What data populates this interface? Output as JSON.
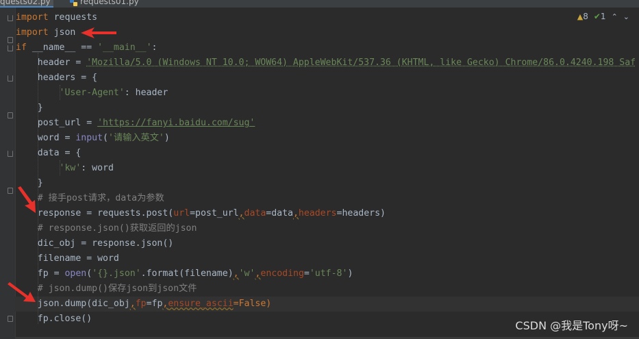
{
  "tabs": [
    {
      "label": "quests02.py",
      "active": true
    },
    {
      "label": "requests01.py",
      "active": false
    }
  ],
  "inspections": {
    "warnings": "8",
    "weak_warnings": "1"
  },
  "code": {
    "l1": {
      "kw": "import",
      "rest": " requests"
    },
    "l2": {
      "kw": "import",
      "rest": " json"
    },
    "l3": {
      "kw": "if",
      "a": " __name__ == ",
      "s": "'__main__'",
      "b": ":"
    },
    "l4": {
      "a": "    header = ",
      "s": "'Mozilla/5.0 (Windows NT 10.0; WOW64) AppleWebKit/537.36 (KHTML, like Gecko) Chrome/86.0.4240.198 Saf"
    },
    "l5": {
      "a": "    headers = {"
    },
    "l6": {
      "s": "        'User-Agent'",
      "b": ": header"
    },
    "l7": {
      "a": "    }"
    },
    "l8": {
      "a": "    post_url = ",
      "s": "'https://fanyi.baidu.com/sug'"
    },
    "l9": {
      "a": "    word = ",
      "fn": "input",
      "b": "(",
      "s": "'请输入英文'",
      "c": ")"
    },
    "l10": {
      "a": "    data = {"
    },
    "l11": {
      "s": "        'kw'",
      "b": ": word"
    },
    "l12": {
      "a": "    }"
    },
    "l13": {
      "cmt": "    # 接手post请求，data为参数"
    },
    "l14": {
      "a": "    response = requests.post(",
      "p1": "url",
      "b": "=post_url",
      "c1": ",",
      "p2": "data",
      "d": "=data",
      "c2": ",",
      "p3": "headers",
      "e": "=headers)"
    },
    "l15": {
      "cmt": "    # response.json()获取返回的json"
    },
    "l16": {
      "a": "    dic_obj = response.json()"
    },
    "l17": {
      "a": "    filename = word"
    },
    "l18": {
      "a": "    fp = ",
      "fn": "open",
      "b": "(",
      "s1": "'{}.json'",
      "c": ".format(filename)",
      "c1": ",",
      "s2": "'w'",
      "c2": ",",
      "p": "encoding",
      "d": "=",
      "s3": "'utf-8'",
      "e": ")"
    },
    "l19": {
      "cmt": "    # json.dump()保存json到json文件"
    },
    "l20": {
      "a": "    json.dump(dic_obj",
      "c1": ",",
      "p1": "fp",
      "b": "=fp",
      "c2": ",",
      "p2": "ensure_ascii",
      "d": "=False)"
    },
    "l21": {
      "a": "    fp.close()"
    }
  },
  "watermark": "CSDN @我是Tony呀~",
  "colors": {
    "background": "#2b2b2b",
    "keyword": "#cc7832",
    "string": "#6a8759",
    "comment": "#808080",
    "annotation_arrow": "#e8312a"
  }
}
